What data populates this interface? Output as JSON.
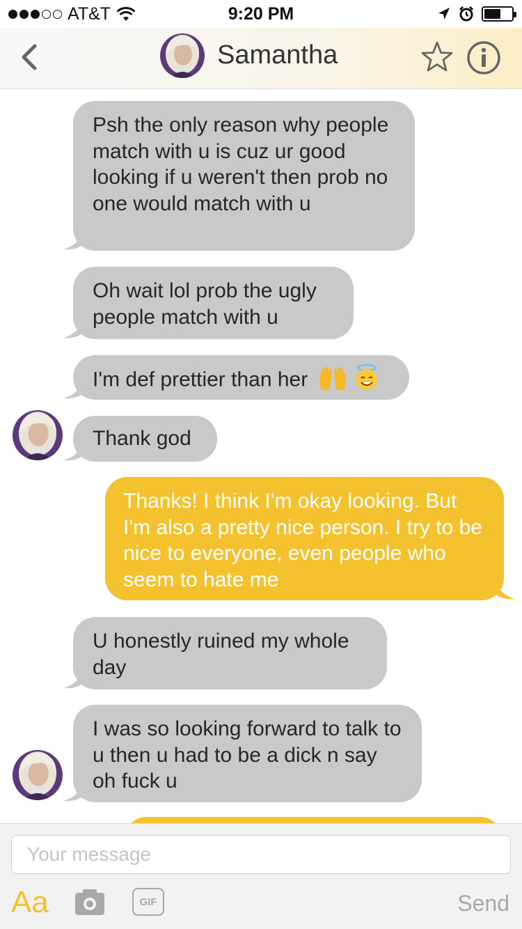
{
  "status_bar": {
    "carrier": "AT&T",
    "time": "9:20 PM",
    "signal_bars_filled": 3,
    "signal_bars_total": 5,
    "battery_level": 0.6
  },
  "header": {
    "contact_name": "Samantha"
  },
  "messages": [
    {
      "from": "them",
      "text": "Psh the only reason why people match with u is cuz ur good looking if u weren't then prob no one would match with u"
    },
    {
      "from": "them",
      "text": "Oh wait lol prob the ugly people match with u"
    },
    {
      "from": "them",
      "text": "I'm def prettier than her",
      "emoji": [
        "raised-hands-emoji",
        "halo-face-emoji"
      ]
    },
    {
      "from": "them",
      "text": "Thank god"
    },
    {
      "from": "me",
      "text": "Thanks! I think I'm okay looking. But I'm also a pretty nice person. I try to be nice to everyone, even people who seem to hate me"
    },
    {
      "from": "them",
      "text": "U honestly ruined my whole day"
    },
    {
      "from": "them",
      "text": "I was so looking forward to talk to u then u had to be a dick n say oh fuck u"
    }
  ],
  "composer": {
    "placeholder": "Your message",
    "format_label": "Aa",
    "gif_label": "GIF",
    "send_label": "Send"
  },
  "colors": {
    "accent": "#f4c12f",
    "incoming_bubble": "#c9c9c9",
    "muted": "#a8a8a8"
  }
}
